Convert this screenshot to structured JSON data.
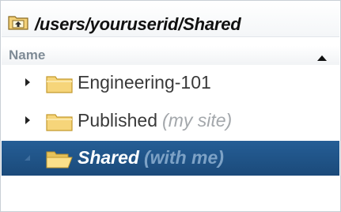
{
  "path_bar": {
    "icon": "folder-up-icon",
    "path": "/users/youruserid/Shared"
  },
  "column_header": {
    "name_label": "Name",
    "sort": "ascending"
  },
  "tree": {
    "items": [
      {
        "label": "Engineering-101",
        "note": "",
        "expanded": false,
        "selected": false
      },
      {
        "label": "Published",
        "note": "(my site)",
        "expanded": false,
        "selected": false
      },
      {
        "label": "Shared",
        "note": "(with me)",
        "expanded": true,
        "selected": true
      }
    ]
  },
  "colors": {
    "selection": "#1f5488",
    "folder": "#f6d57a",
    "folder_outline": "#c49a2e"
  }
}
